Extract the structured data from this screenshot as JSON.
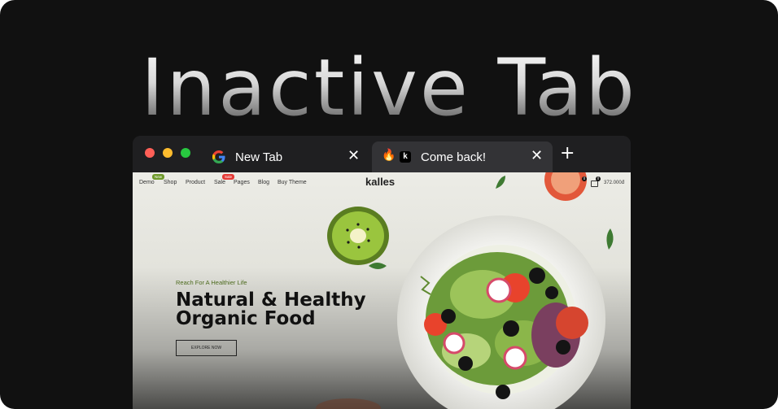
{
  "hero": {
    "title": "Inactive Tab"
  },
  "tabs": [
    {
      "label": "New Tab",
      "close": "✕",
      "icon": "google-icon"
    },
    {
      "label": "Come back!",
      "close": "✕",
      "icon": "fire-icon",
      "badge": "k"
    }
  ],
  "new_tab_button": "+",
  "site": {
    "logo": "kalles",
    "nav": [
      "Demo",
      "Shop",
      "Product",
      "Sale",
      "Pages",
      "Blog",
      "Buy Theme"
    ],
    "nav_badges": {
      "demo": "New",
      "sale": "Sale"
    },
    "wishlist_count": "0",
    "cart_count": "0",
    "cart_price": "372.000đ",
    "hero": {
      "eyebrow": "Reach For A Healthier Life",
      "headline_line1": "Natural & Healthy",
      "headline_line2": "Organic Food",
      "cta": "EXPLORE NOW"
    }
  },
  "colors": {
    "traffic_red": "#ff5f57",
    "traffic_yellow": "#febc2e",
    "traffic_green": "#28c840",
    "tab_active_bg": "#333336",
    "tabbar_bg": "#1f1f21",
    "nav_badge_new": "#6f9a2b",
    "nav_badge_sale": "#e53935"
  }
}
